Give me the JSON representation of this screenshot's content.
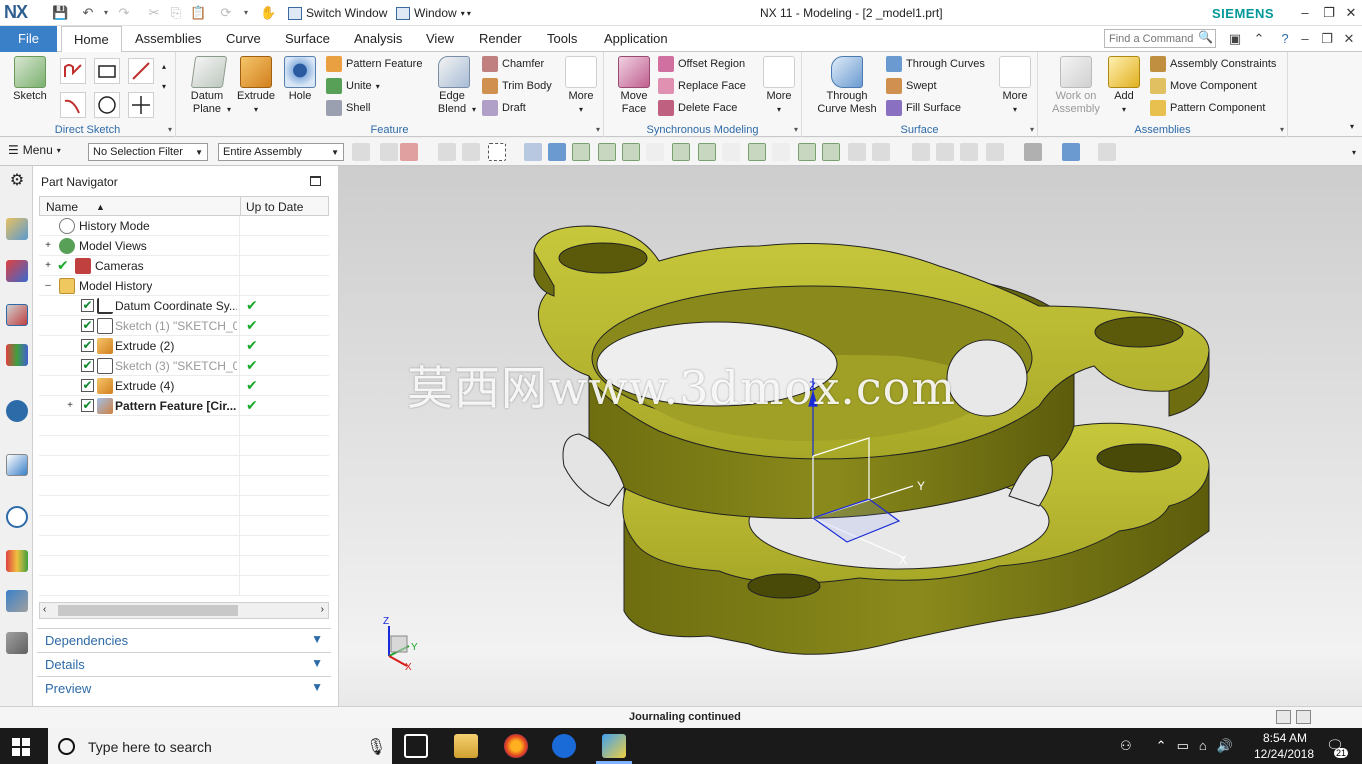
{
  "titlebar": {
    "logo": "NX",
    "switch_window": "Switch Window",
    "window_menu": "Window",
    "title": "NX 11 - Modeling - [2 _model1.prt]",
    "brand": "SIEMENS"
  },
  "tabs": {
    "file": "File",
    "items": [
      "Home",
      "Assemblies",
      "Curve",
      "Surface",
      "Analysis",
      "View",
      "Render",
      "Tools",
      "Application"
    ],
    "active": "Home",
    "find_placeholder": "Find a Command"
  },
  "ribbon": {
    "direct_sketch": {
      "label": "Direct Sketch",
      "sketch": "Sketch"
    },
    "feature": {
      "label": "Feature",
      "datum_plane": "Datum Plane",
      "extrude": "Extrude",
      "hole": "Hole",
      "pattern_feature": "Pattern Feature",
      "unite": "Unite",
      "shell": "Shell",
      "edge_blend": "Edge Blend",
      "chamfer": "Chamfer",
      "trim_body": "Trim Body",
      "draft": "Draft",
      "more": "More"
    },
    "synchronous": {
      "label": "Synchronous Modeling",
      "move_face": "Move Face",
      "offset_region": "Offset Region",
      "replace_face": "Replace Face",
      "delete_face": "Delete Face",
      "more": "More"
    },
    "surface": {
      "label": "Surface",
      "through_curve_mesh": "Through Curve Mesh",
      "through_curves": "Through Curves",
      "swept": "Swept",
      "fill_surface": "Fill Surface",
      "more": "More"
    },
    "assemblies": {
      "label": "Assemblies",
      "work_on_assembly": "Work on Assembly",
      "add": "Add",
      "assembly_constraints": "Assembly Constraints",
      "move_component": "Move Component",
      "pattern_component": "Pattern Component"
    }
  },
  "seltoolbar": {
    "menu": "Menu",
    "filter": "No Selection Filter",
    "scope": "Entire Assembly"
  },
  "part_navigator": {
    "title": "Part Navigator",
    "col_name": "Name",
    "col_uptodate": "Up to Date",
    "rows": [
      {
        "label": "History Mode"
      },
      {
        "label": "Model Views"
      },
      {
        "label": "Cameras"
      },
      {
        "label": "Model History"
      },
      {
        "label": "Datum Coordinate Sy..."
      },
      {
        "label": "Sketch (1) \"SKETCH_0..."
      },
      {
        "label": "Extrude (2)"
      },
      {
        "label": "Sketch (3) \"SKETCH_0..."
      },
      {
        "label": "Extrude (4)"
      },
      {
        "label": "Pattern Feature [Cir..."
      }
    ],
    "sections": [
      "Dependencies",
      "Details",
      "Preview"
    ]
  },
  "graphics": {
    "watermark": "莫西网www.3dmox.com",
    "part_color": "#b8b832",
    "triad": {
      "x": "X",
      "y": "Y",
      "z": "Z"
    }
  },
  "status": {
    "text": "Journaling continued"
  },
  "taskbar": {
    "search_placeholder": "Type here to search",
    "time": "8:54 AM",
    "date": "12/24/2018",
    "notifications": "21"
  }
}
